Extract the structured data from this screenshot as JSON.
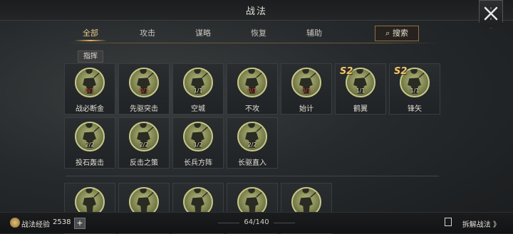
{
  "header": {
    "title": "战法"
  },
  "tabs": [
    {
      "label": "全部",
      "active": true
    },
    {
      "label": "攻击"
    },
    {
      "label": "谋略"
    },
    {
      "label": "恢复"
    },
    {
      "label": "辅助"
    }
  ],
  "search": {
    "label": "搜索"
  },
  "section": {
    "label": "指挥"
  },
  "row1": [
    {
      "name": "战必断金",
      "level": "0/1",
      "red": true
    },
    {
      "name": "先驱突击",
      "level": "0/1",
      "red": true
    },
    {
      "name": "空城",
      "level": "1/1"
    },
    {
      "name": "不攻",
      "level": "0/1",
      "red": true
    },
    {
      "name": "始计",
      "level": "0/1",
      "red": true
    },
    {
      "name": "鹤翼",
      "level": "1/1",
      "badge": "S2"
    },
    {
      "name": "锋矢",
      "level": "1/1",
      "badge": "S2"
    }
  ],
  "row2": [
    {
      "name": "投石轰击",
      "level": "2/2"
    },
    {
      "name": "反击之策",
      "level": "2/2"
    },
    {
      "name": "长兵方阵",
      "level": "1/2"
    },
    {
      "name": "长驱直入",
      "level": "2/2"
    }
  ],
  "footer": {
    "exp_label": "战法经验",
    "exp_value": "2538",
    "plus": "+",
    "count": "64/140",
    "dismantle": "拆解战法 》"
  },
  "colors": {
    "accent": "#e9c98a",
    "level_red": "#e04a3c",
    "badge": "#f1c970"
  }
}
